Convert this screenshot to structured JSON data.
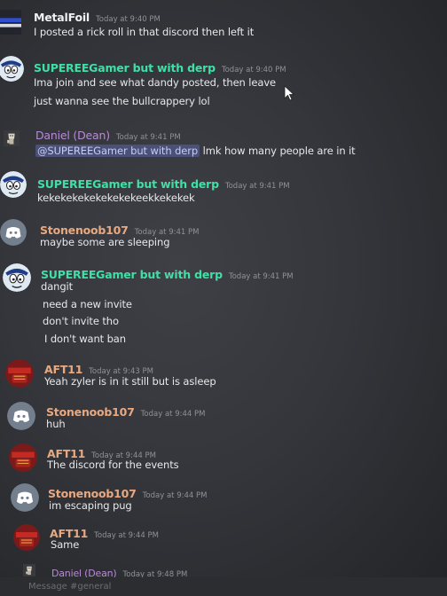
{
  "colors": {
    "metalfoil": "#eef0f2",
    "supereegamer": "#3fe0a6",
    "daniel": "#b98ad9",
    "stonenoob": "#e8a880",
    "aft11": "#e8a880"
  },
  "messages": [
    {
      "author": "MetalFoil",
      "time": "Today at 9:40 PM",
      "avatar": "custom-avatar",
      "lines": [
        "I posted a rick roll in that discord then left it"
      ]
    },
    {
      "author": "SUPEREEGamer but with derp",
      "time": "Today at 9:40 PM",
      "avatar": "cartoon-avatar",
      "lines": [
        "Ima join and see what dandy posted, then leave",
        "just wanna see the bullcrappery lol"
      ]
    },
    {
      "author": "Daniel (Dean)",
      "time": "Today at 9:41 PM",
      "avatar": "character-avatar",
      "mention": "@SUPEREEGamer but with derp",
      "lines": [
        "lmk how many people are in it"
      ]
    },
    {
      "author": "SUPEREEGamer but with derp",
      "time": "Today at 9:41 PM",
      "avatar": "cartoon-avatar",
      "lines": [
        "kekekekekekekekekeekkekekek"
      ]
    },
    {
      "author": "Stonenoob107",
      "time": "Today at 9:41 PM",
      "avatar": "default-discord-avatar",
      "lines": [
        "maybe some are sleeping"
      ]
    },
    {
      "author": "SUPEREEGamer but with derp",
      "time": "Today at 9:41 PM",
      "avatar": "cartoon-avatar",
      "lines": [
        "dangit",
        "need a new invite",
        "don't invite tho",
        "I don't want ban"
      ]
    },
    {
      "author": "AFT11",
      "time": "Today at 9:43 PM",
      "avatar": "arsenal-avatar",
      "lines": [
        "Yeah zyler is in it still but is asleep"
      ]
    },
    {
      "author": "Stonenoob107",
      "time": "Today at 9:44 PM",
      "avatar": "default-discord-avatar",
      "lines": [
        "huh"
      ]
    },
    {
      "author": "AFT11",
      "time": "Today at 9:44 PM",
      "avatar": "arsenal-avatar",
      "lines": [
        "The discord for the events"
      ]
    },
    {
      "author": "Stonenoob107",
      "time": "Today at 9:44 PM",
      "avatar": "default-discord-avatar",
      "lines": [
        "im escaping pug"
      ]
    },
    {
      "author": "AFT11",
      "time": "Today at 9:44 PM",
      "avatar": "arsenal-avatar",
      "lines": [
        "Same"
      ]
    },
    {
      "author": "Daniel (Dean)",
      "time": "Today at 9:48 PM",
      "avatar": "character-avatar",
      "lines": []
    }
  ],
  "composer": {
    "placeholder": "Message #general"
  }
}
